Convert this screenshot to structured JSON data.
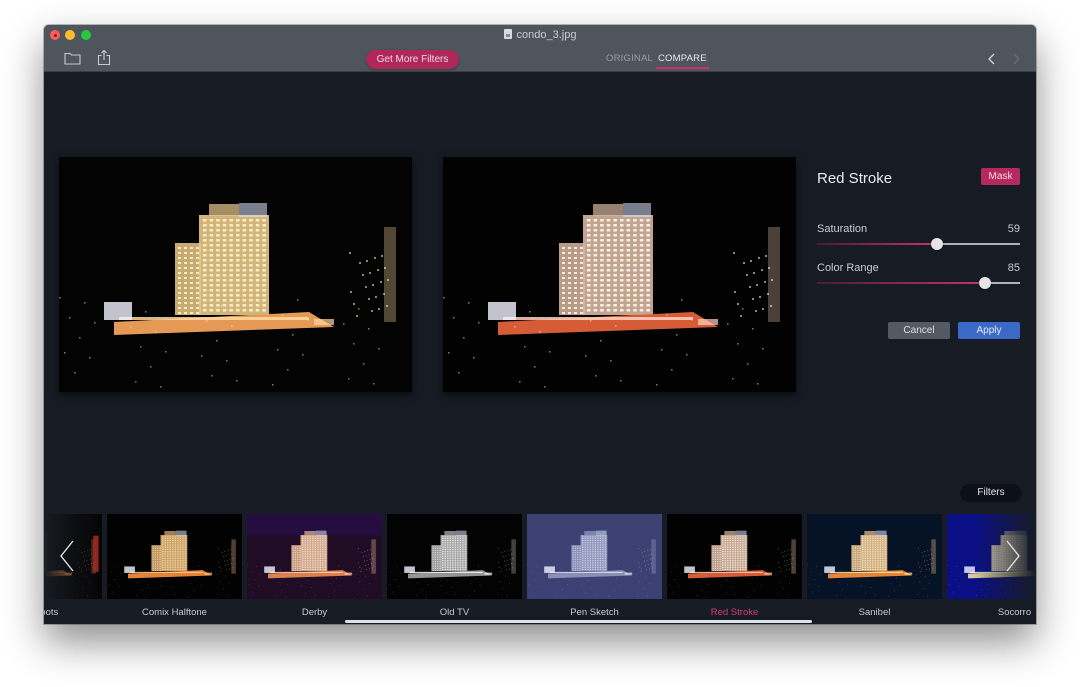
{
  "window": {
    "title": "condo_3.jpg",
    "file_icon": "image-file-icon"
  },
  "toolbar": {
    "open_icon": "folder-icon",
    "share_icon": "share-icon",
    "get_more_filters_label": "Get More Filters",
    "tabs": [
      {
        "label": "ORIGINAL",
        "active": false
      },
      {
        "label": "COMPARE",
        "active": true
      }
    ],
    "prev_icon": "chevron-left-icon",
    "next_icon": "chevron-right-icon"
  },
  "previews": {
    "original": {
      "label": "original-image"
    },
    "filtered": {
      "label": "filtered-image"
    }
  },
  "panel": {
    "filter_name": "Red Stroke",
    "mask_label": "Mask",
    "sliders": [
      {
        "label": "Saturation",
        "value": "59",
        "fraction": 0.59
      },
      {
        "label": "Color Range",
        "value": "85",
        "fraction": 0.83
      }
    ],
    "cancel_label": "Cancel",
    "apply_label": "Apply"
  },
  "strip": {
    "filters_label": "Filters",
    "items": [
      {
        "label": "Light Spots",
        "selected": false,
        "tint": "light-spots"
      },
      {
        "label": "Comix Halftone",
        "selected": false,
        "tint": "comix"
      },
      {
        "label": "Derby",
        "selected": false,
        "tint": "derby"
      },
      {
        "label": "Old TV",
        "selected": false,
        "tint": "oldtv"
      },
      {
        "label": "Pen Sketch",
        "selected": false,
        "tint": "pensketch"
      },
      {
        "label": "Red Stroke",
        "selected": true,
        "tint": "redstroke"
      },
      {
        "label": "Sanibel",
        "selected": false,
        "tint": "sanibel"
      },
      {
        "label": "Socorro",
        "selected": false,
        "tint": "socorro"
      }
    ],
    "prev_icon": "chevron-left-icon",
    "next_icon": "chevron-right-icon"
  },
  "colors": {
    "accent": "#c8336c",
    "apply": "#3b69c8",
    "background": "#171c24",
    "titlebar": "#4f555d"
  }
}
